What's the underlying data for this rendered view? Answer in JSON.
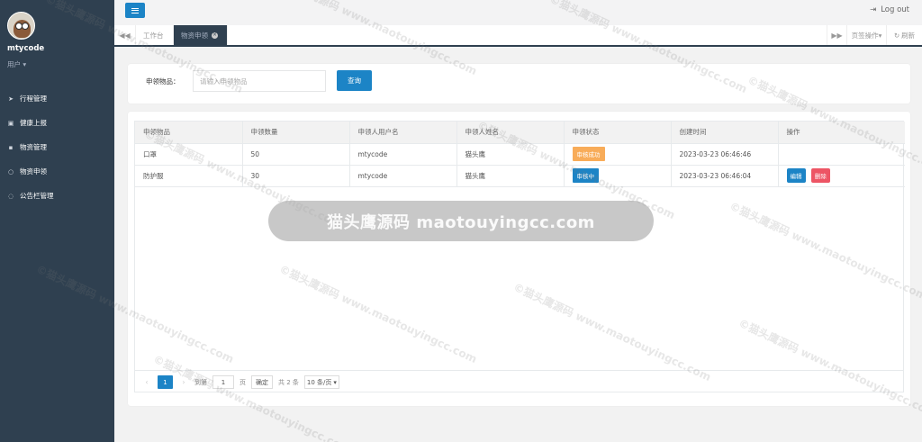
{
  "sidebar": {
    "username": "mtycode",
    "role": "用户 ▾",
    "items": [
      {
        "label": "行程管理",
        "icon": "send-icon"
      },
      {
        "label": "健康上报",
        "icon": "calendar-icon"
      },
      {
        "label": "物资管理",
        "icon": "boxes-icon"
      },
      {
        "label": "物资申领",
        "icon": "hand-icon"
      },
      {
        "label": "公告栏管理",
        "icon": "comment-icon"
      }
    ]
  },
  "topbar": {
    "logout_label": "Log out"
  },
  "tabs": {
    "home_label": "工作台",
    "active_label": "物资申领",
    "ops_label": "页签操作▾",
    "refresh_label": "刷新"
  },
  "search": {
    "label": "申领物品：",
    "placeholder": "请输入申领物品",
    "button_label": "查询"
  },
  "table": {
    "headers": [
      "申领物品",
      "申领数量",
      "申领人用户名",
      "申领人姓名",
      "申领状态",
      "创建时间",
      "操作"
    ],
    "rows": [
      {
        "item": "口罩",
        "quantity": "50",
        "username": "mtycode",
        "name": "猫头鹰",
        "status": "审核成功",
        "created": "2023-03-23 06:46:46",
        "ops": []
      },
      {
        "item": "防护服",
        "quantity": "30",
        "username": "mtycode",
        "name": "猫头鹰",
        "status": "审核中",
        "created": "2023-03-23 06:46:04",
        "ops": [
          "编辑",
          "删除"
        ]
      }
    ]
  },
  "pager": {
    "current": "1",
    "goto_label": "到第",
    "goto_value": "1",
    "page_unit": "页",
    "confirm_label": "确定",
    "total": "共 2 条",
    "page_size": "10 条/页"
  },
  "watermark": {
    "repeat_text": "©猫头鹰源码 www.maotouyingcc.com",
    "banner_text": "猫头鹰源码 maotouyingcc.com"
  },
  "colors": {
    "sidebar_bg": "#2f4050",
    "primary": "#1c84c6",
    "warning": "#f8ac59",
    "danger": "#ed5565"
  }
}
